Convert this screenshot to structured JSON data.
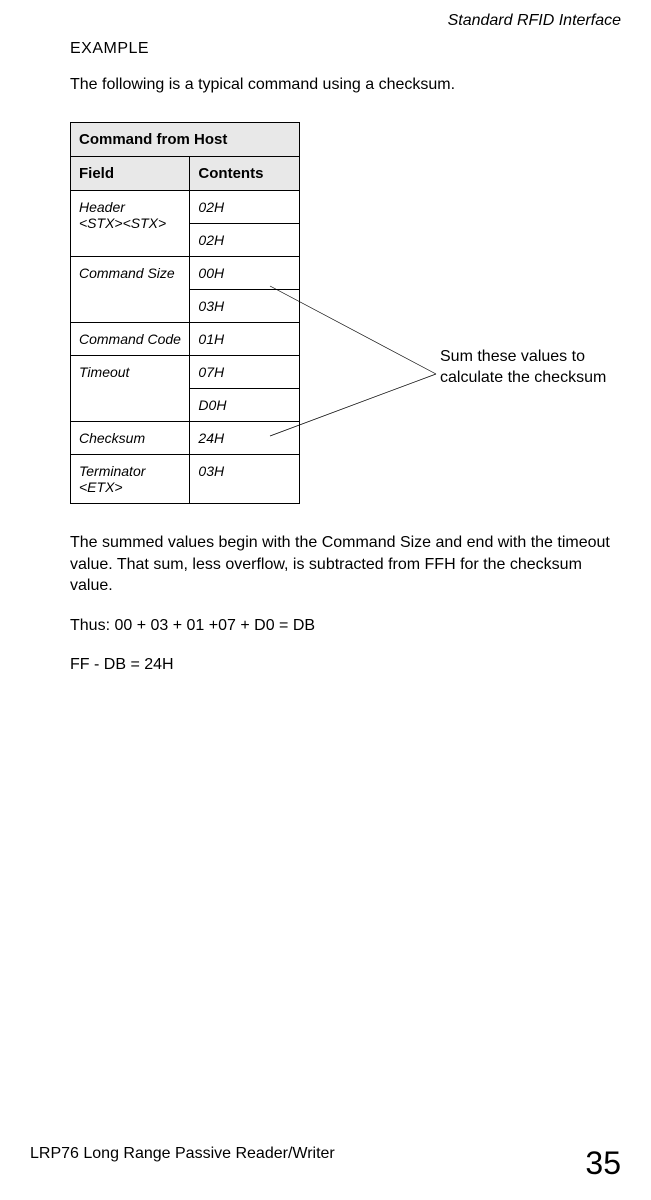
{
  "header": {
    "title": "Standard RFID Interface"
  },
  "example": {
    "heading": "EXAMPLE",
    "intro": "The following is a typical command using a checksum."
  },
  "table": {
    "title": "Command from Host",
    "col_field": "Field",
    "col_contents": "Contents",
    "rows": [
      {
        "field": "Header\n<STX><STX>",
        "c1": "02H",
        "c2": "02H"
      },
      {
        "field": "Command Size",
        "c1": "00H",
        "c2": "03H"
      },
      {
        "field": "Command Code",
        "c1": "01H"
      },
      {
        "field": "Timeout",
        "c1": "07H",
        "c2": "D0H"
      },
      {
        "field": "Checksum",
        "c1": "24H"
      },
      {
        "field": "Terminator <ETX>",
        "c1": "03H"
      }
    ]
  },
  "annotation": {
    "line1": "Sum these values to",
    "line2": "calculate the checksum"
  },
  "body": {
    "p1": "The summed values begin with the Command Size and end with the timeout value. That sum, less overflow, is subtracted from FFH for the checksum value.",
    "p2": "Thus: 00 + 03 + 01 +07 + D0 = DB",
    "p3": "FF - DB = 24H"
  },
  "footer": {
    "left": "LRP76 Long Range Passive Reader/Writer",
    "right": "35"
  }
}
